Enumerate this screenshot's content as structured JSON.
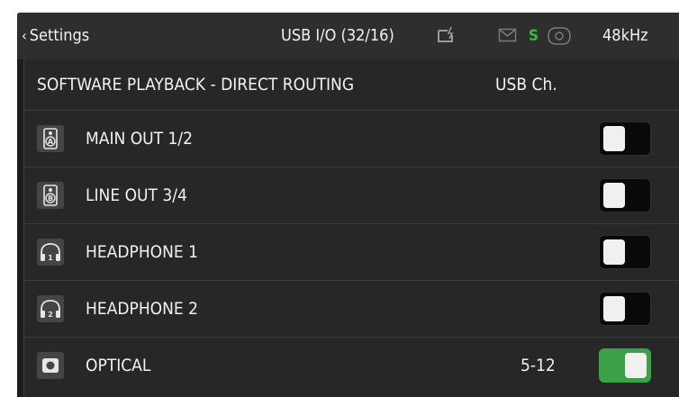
{
  "topbar": {
    "back_label": "Settings",
    "back_glyph": "‹",
    "device_mode": "USB I/O (32/16)",
    "sync_indicator": "S",
    "sample_rate": "48kHz",
    "icons": [
      "edit-lock-icon",
      "mail-icon",
      "sync-icon",
      "camera-icon"
    ],
    "sync_color": "#31c03b"
  },
  "section": {
    "title": "SOFTWARE PLAYBACK - DIRECT ROUTING",
    "column_header": "USB Ch."
  },
  "rows": [
    {
      "label": "MAIN OUT 1/2",
      "icon": "speaker-a-icon",
      "channels": "",
      "enabled": false
    },
    {
      "label": "LINE OUT 3/4",
      "icon": "speaker-b-icon",
      "channels": "",
      "enabled": false
    },
    {
      "label": "HEADPHONE 1",
      "icon": "headphone-1-icon",
      "channels": "",
      "enabled": false
    },
    {
      "label": "HEADPHONE 2",
      "icon": "headphone-2-icon",
      "channels": "",
      "enabled": false
    },
    {
      "label": "OPTICAL",
      "icon": "optical-icon",
      "channels": "5-12",
      "enabled": true
    }
  ],
  "colors": {
    "toggle_on": "#3aa147",
    "toggle_off": "#090909",
    "background": "#1c1c1c"
  }
}
